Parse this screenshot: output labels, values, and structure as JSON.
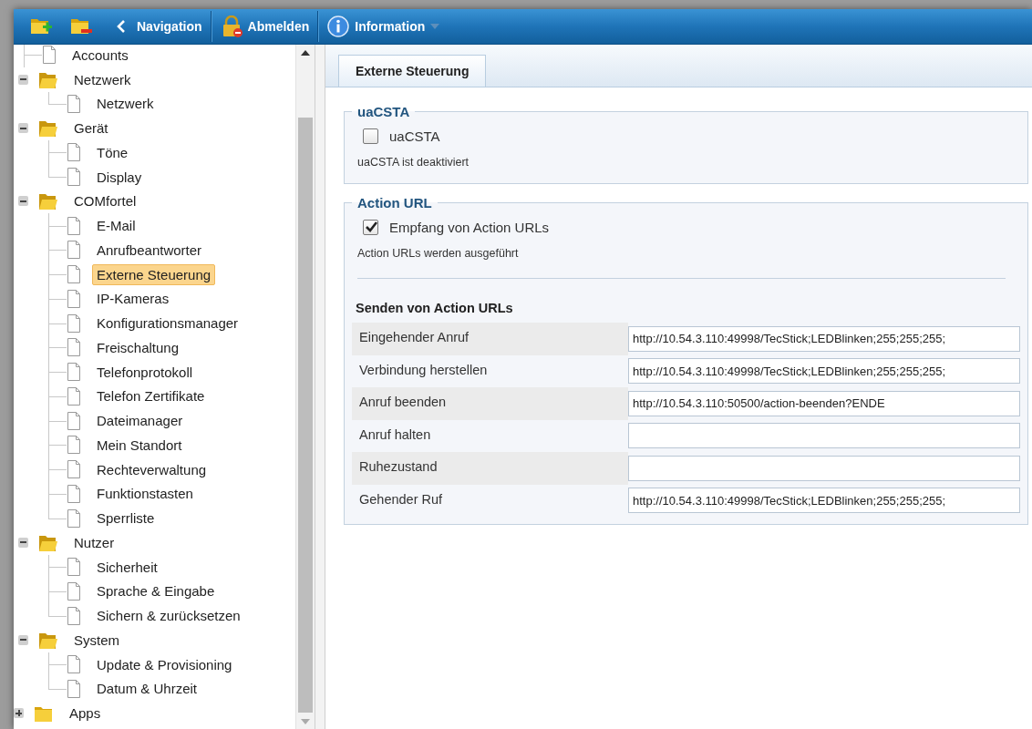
{
  "toolbar": {
    "buttons": [
      {
        "kind": "folder-add"
      },
      {
        "kind": "folder-remove"
      },
      {
        "kind": "back",
        "label": "Navigation"
      },
      {
        "kind": "lock",
        "label": "Abmelden"
      },
      {
        "kind": "info",
        "label": "Information",
        "dropdown": true
      }
    ]
  },
  "tree": {
    "items": [
      {
        "kind": "scrolled",
        "children": [
          {
            "kind": "leaf",
            "label": "Accounts",
            "selected": false
          },
          {
            "kind": "folder",
            "label": "Netzwerk",
            "expanded": true,
            "selected": false,
            "children": [
              {
                "kind": "leaf",
                "label": "Netzwerk",
                "selected": false
              }
            ]
          },
          {
            "kind": "folder",
            "label": "Gerät",
            "expanded": true,
            "selected": false,
            "children": [
              {
                "kind": "leaf",
                "label": "Töne",
                "selected": false
              },
              {
                "kind": "leaf",
                "label": "Display",
                "selected": false
              }
            ]
          },
          {
            "kind": "folder",
            "label": "COMfortel",
            "expanded": true,
            "selected": false,
            "children": [
              {
                "kind": "leaf",
                "label": "E-Mail",
                "selected": false
              },
              {
                "kind": "leaf",
                "label": "Anrufbeantworter",
                "selected": false
              },
              {
                "kind": "leaf",
                "label": "Externe Steuerung",
                "selected": true
              },
              {
                "kind": "leaf",
                "label": "IP-Kameras",
                "selected": false
              },
              {
                "kind": "leaf",
                "label": "Konfigurationsmanager",
                "selected": false
              },
              {
                "kind": "leaf",
                "label": "Freischaltung",
                "selected": false
              },
              {
                "kind": "leaf",
                "label": "Telefonprotokoll",
                "selected": false
              },
              {
                "kind": "leaf",
                "label": "Telefon Zertifikate",
                "selected": false
              },
              {
                "kind": "leaf",
                "label": "Dateimanager",
                "selected": false
              },
              {
                "kind": "leaf",
                "label": "Mein Standort",
                "selected": false
              },
              {
                "kind": "leaf",
                "label": "Rechteverwaltung",
                "selected": false
              },
              {
                "kind": "leaf",
                "label": "Funktionstasten",
                "selected": false
              },
              {
                "kind": "leaf",
                "label": "Sperrliste",
                "selected": false
              }
            ]
          },
          {
            "kind": "folder",
            "label": "Nutzer",
            "expanded": true,
            "selected": false,
            "children": [
              {
                "kind": "leaf",
                "label": "Sicherheit",
                "selected": false
              },
              {
                "kind": "leaf",
                "label": "Sprache & Eingabe",
                "selected": false
              },
              {
                "kind": "leaf",
                "label": "Sichern & zurücksetzen",
                "selected": false
              }
            ]
          },
          {
            "kind": "folder",
            "label": "System",
            "expanded": true,
            "selected": false,
            "children": [
              {
                "kind": "leaf",
                "label": "Update & Provisioning",
                "selected": false
              },
              {
                "kind": "leaf",
                "label": "Datum & Uhrzeit",
                "selected": false
              }
            ]
          }
        ]
      },
      {
        "kind": "folder",
        "label": "Apps",
        "expanded": false,
        "selected": false
      }
    ]
  },
  "tabs": [
    {
      "label": "Externe Steuerung",
      "selected": true
    }
  ],
  "sections": [
    {
      "legend": "uaCSTA",
      "checkbox": {
        "label": "uaCSTA",
        "checked": false
      },
      "note": "uaCSTA ist deaktiviert"
    },
    {
      "legend": "Action URL",
      "checkbox": {
        "label": "Empfang von Action URLs",
        "checked": true
      },
      "note": "Action URLs werden ausgeführt",
      "subheading": "Senden von Action URLs",
      "fields": [
        {
          "label": "Eingehender Anruf",
          "value": "http://10.54.3.110:49998/TecStick;LEDBlinken;255;255;255;"
        },
        {
          "label": "Verbindung herstellen",
          "value": "http://10.54.3.110:49998/TecStick;LEDBlinken;255;255;255;"
        },
        {
          "label": "Anruf beenden",
          "value": "http://10.54.3.110:50500/action-beenden?ENDE"
        },
        {
          "label": "Anruf halten"
        },
        {
          "label": "Ruhezustand"
        },
        {
          "label": "Gehender Ruf",
          "value": "http://10.54.3.110:49998/TecStick;LEDBlinken;255;255;255;"
        }
      ]
    }
  ]
}
